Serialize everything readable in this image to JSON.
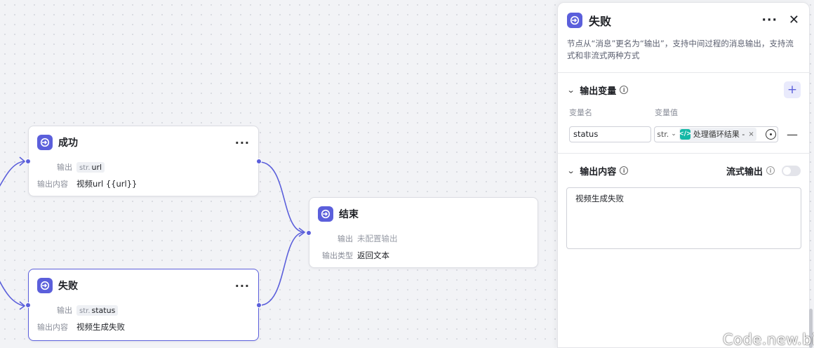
{
  "nodes": {
    "success": {
      "title": "成功",
      "output_label": "输出",
      "output_type": "str.",
      "output_var": "url",
      "content_label": "输出内容",
      "content_value": "视频url {{url}}"
    },
    "end": {
      "title": "结束",
      "output_label": "输出",
      "output_value": "未配置输出",
      "type_label": "输出类型",
      "type_value": "返回文本"
    },
    "fail": {
      "title": "失败",
      "output_label": "输出",
      "output_type": "str.",
      "output_var": "status",
      "content_label": "输出内容",
      "content_value": "视频生成失败"
    }
  },
  "panel": {
    "title": "失败",
    "description": "节点从“消息”更名为“输出”，支持中间过程的消息输出，支持流式和非流式两种方式",
    "output_vars": {
      "title": "输出变量",
      "col_name": "变量名",
      "col_value": "变量值",
      "rows": [
        {
          "name": "status",
          "type": "str.",
          "ref": "处理循环结果 -"
        }
      ]
    },
    "output_content": {
      "title": "输出内容",
      "stream_label": "流式输出",
      "stream_enabled": false,
      "value": "视频生成失败"
    }
  },
  "colors": {
    "accent": "#5b5fdb",
    "chip": "#14b8a6"
  },
  "watermark": "Code.new.bi"
}
